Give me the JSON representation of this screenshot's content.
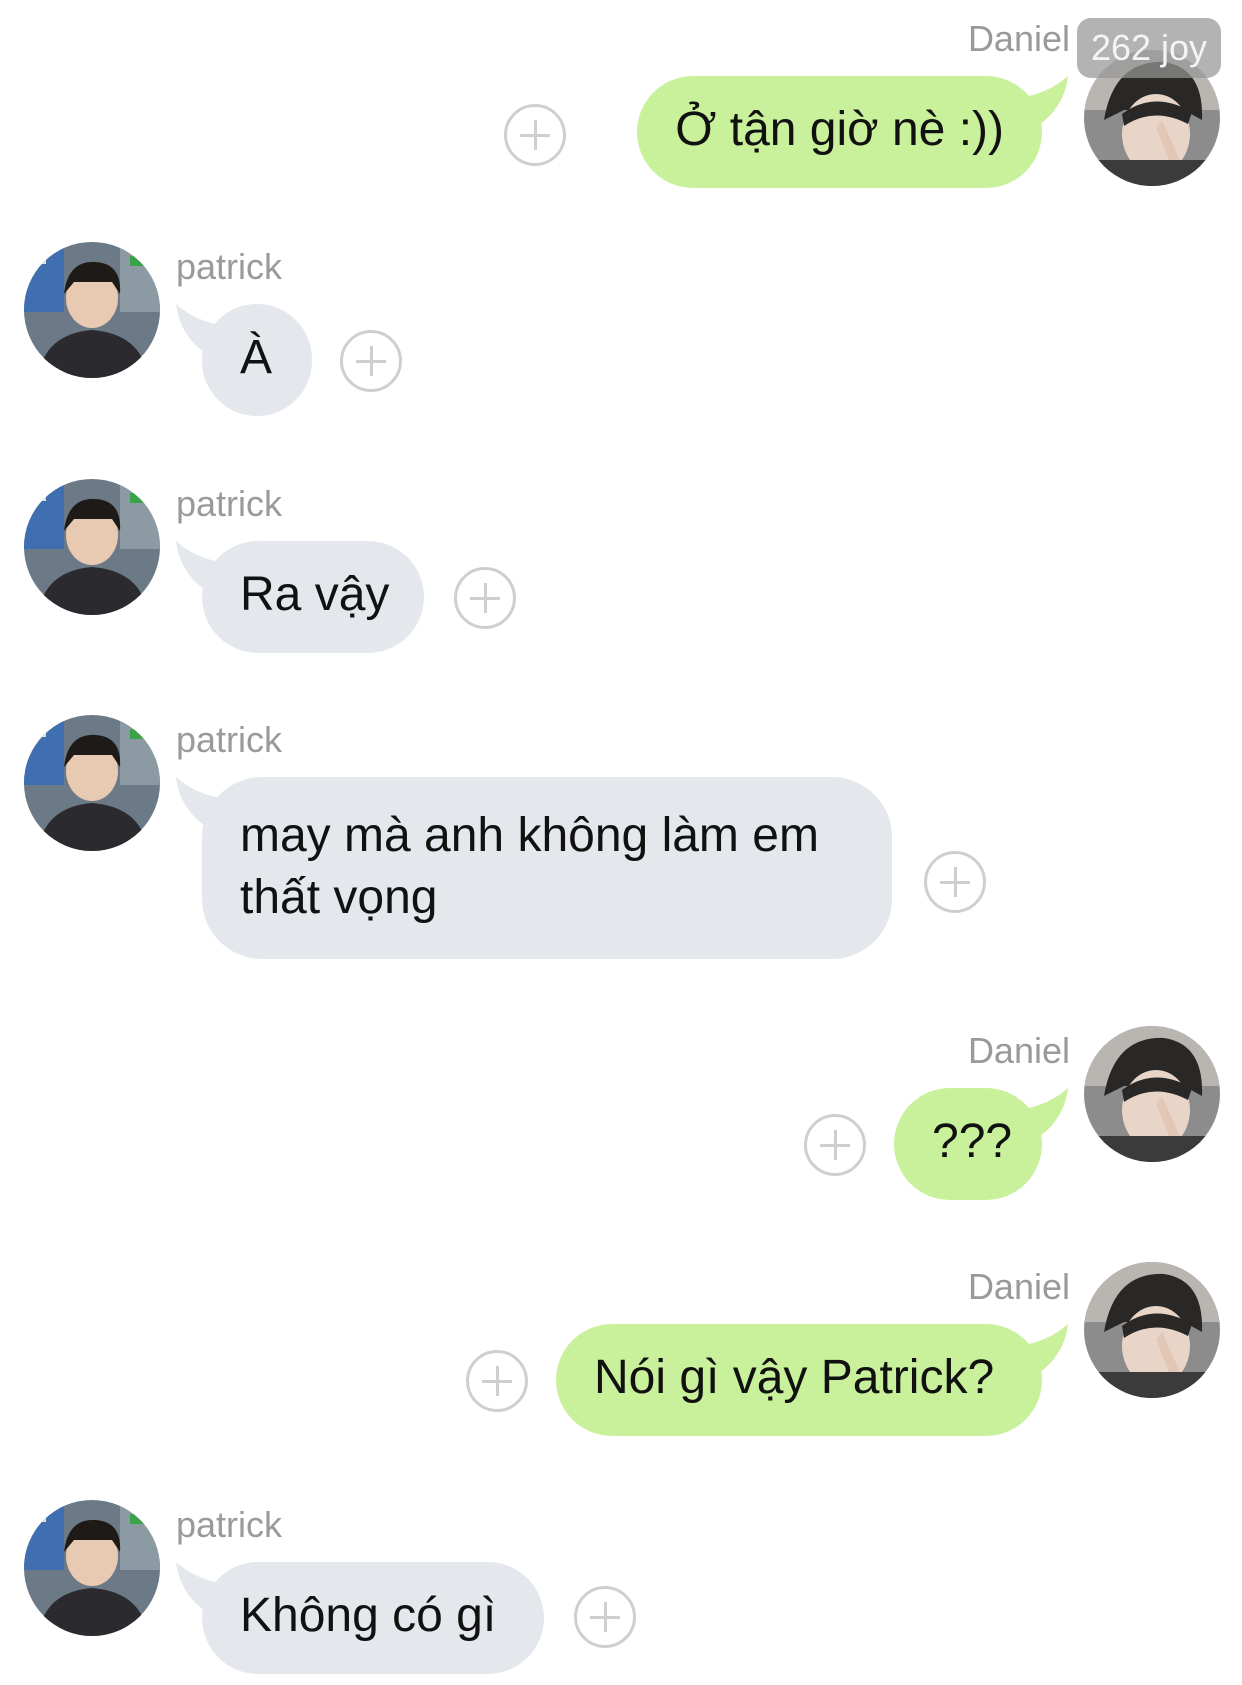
{
  "watermark": "262 joy",
  "colors": {
    "outgoing_bubble": "#c9f19b",
    "incoming_bubble": "#e4e8ed",
    "sender_name": "#9a9a9a",
    "background": "#ffffff"
  },
  "messages": [
    {
      "sender": "Daniel",
      "side": "right",
      "text": "Ở tận giờ nè :))"
    },
    {
      "sender": "patrick",
      "side": "left",
      "text": "À"
    },
    {
      "sender": "patrick",
      "side": "left",
      "text": "Ra vậy"
    },
    {
      "sender": "patrick",
      "side": "left",
      "text_lines": [
        "may mà anh không làm em",
        "thất vọng"
      ]
    },
    {
      "sender": "Daniel",
      "side": "right",
      "text": "???"
    },
    {
      "sender": "Daniel",
      "side": "right",
      "text": "Nói gì vậy Patrick?"
    },
    {
      "sender": "patrick",
      "side": "left",
      "text": "Không có gì"
    }
  ],
  "icons": {
    "add_reaction": "plus-circle-icon",
    "avatar_daniel": "avatar",
    "avatar_patrick": "avatar"
  }
}
